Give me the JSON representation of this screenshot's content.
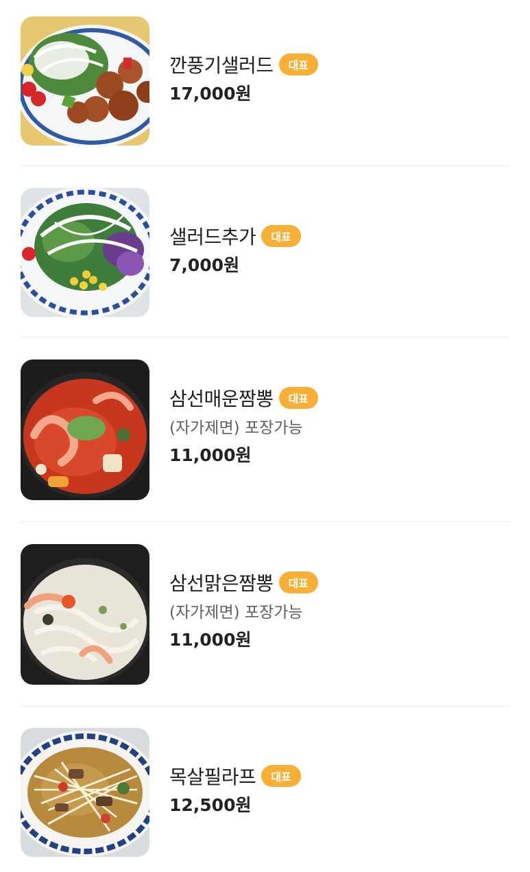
{
  "menu": {
    "items": [
      {
        "name": "깐풍기샐러드",
        "badge": "대표",
        "description": "",
        "price": "17,000원",
        "image_kind": "salad-chicken"
      },
      {
        "name": "샐러드추가",
        "badge": "대표",
        "description": "",
        "price": "7,000원",
        "image_kind": "salad"
      },
      {
        "name": "삼선매운짬뽕",
        "badge": "대표",
        "description": "(자가제면) 포장가능",
        "price": "11,000원",
        "image_kind": "spicy-jjamppong"
      },
      {
        "name": "삼선맑은짬뽕",
        "badge": "대표",
        "description": "(자가제면) 포장가능",
        "price": "11,000원",
        "image_kind": "white-jjamppong"
      },
      {
        "name": "목살필라프",
        "badge": "대표",
        "description": "",
        "price": "12,500원",
        "image_kind": "pilaf"
      }
    ]
  },
  "colors": {
    "badge_bg": "#f7b035",
    "badge_text": "#ffffff",
    "divider": "#ececec",
    "name_text": "#1e1e1e",
    "desc_text": "#5f5f5f"
  }
}
